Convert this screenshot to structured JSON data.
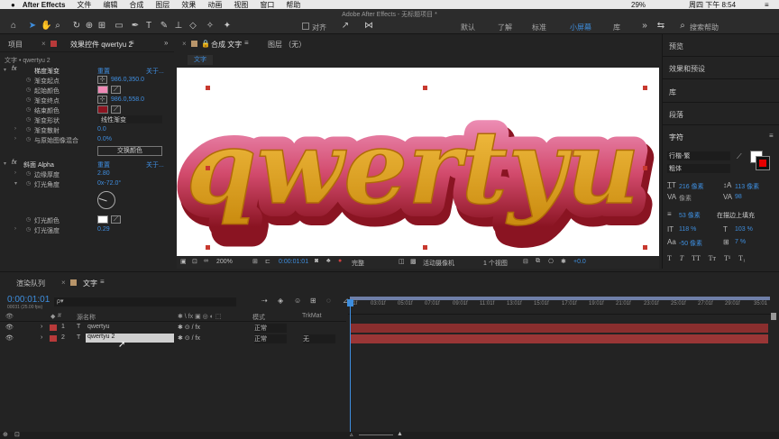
{
  "menubar": {
    "app": "After Effects",
    "items": [
      "文件",
      "编辑",
      "合成",
      "图层",
      "效果",
      "动画",
      "视图",
      "窗口",
      "帮助"
    ],
    "battery": "29%",
    "clock": "周四 下午 8:54"
  },
  "toolbar": {
    "title": "Adobe After Effects - 无标题项目 *",
    "align": "对齐",
    "workspaces": [
      "默认",
      "了解",
      "标准",
      "小屏幕",
      "库"
    ],
    "active_workspace": "小屏幕",
    "search_placeholder": "搜索帮助"
  },
  "left": {
    "tab_project": "项目",
    "tab_effects": "效果控件 qwertyu 2",
    "breadcrumb": "文字 • qwertyu 2",
    "gradient": {
      "name": "梯度渐变",
      "reset": "重置",
      "about": "关于...",
      "start_label": "渐变起点",
      "start_val": "986.0,350.0",
      "start_color_label": "起始颜色",
      "start_color": "#f08ab6",
      "end_label": "渐变终点",
      "end_val": "986.0,558.0",
      "end_color_label": "结束颜色",
      "end_color": "#8c1420",
      "shape_label": "渐变形状",
      "shape_val": "线性渐变",
      "scatter_label": "渐变散射",
      "scatter_val": "0.0",
      "blend_label": "与原始图像混合",
      "blend_val": "0.0%",
      "swap_btn": "交换颜色"
    },
    "bevel": {
      "name": "斜面 Alpha",
      "reset": "重置",
      "about": "关于...",
      "depth_label": "边缘厚度",
      "depth_val": "2.80",
      "angle_label": "灯光角度",
      "angle_val": "0x-72.0°",
      "light_color_label": "灯光颜色",
      "intensity_label": "灯光强度",
      "intensity_val": "0.29"
    }
  },
  "comp": {
    "tab": "合成 文字",
    "layer_tab": "图层 （无）",
    "subtab": "文字",
    "text": "qwertyu",
    "zoom": "200%",
    "time": "0:00:01:01",
    "quality": "完整",
    "camera": "活动摄像机",
    "views": "1 个视图",
    "exposure": "+0.0"
  },
  "right": {
    "items": [
      "预览",
      "效果和预设",
      "库",
      "段落"
    ],
    "char_title": "字符",
    "font": "行楷-繁",
    "style": "粗体",
    "size": "216 像素",
    "leading": "113 像素",
    "kern": "像素",
    "tracking": "98",
    "stroke_w": "53 像素",
    "stroke_mode": "在描边上填充",
    "vscale": "118 %",
    "hscale": "103 %",
    "baseline": "-50 像素",
    "tsume": "7 %",
    "fill_color": "#ffffff",
    "stroke_color": "#e60000"
  },
  "timeline": {
    "tab_render": "渲染队列",
    "tab_comp": "文字",
    "timecode": "0:00:01:01",
    "fps": "00031 (25.00 fps)",
    "search_placeholder": "ρ▾",
    "headers": {
      "name": "源名称",
      "mode": "模式",
      "trkmat": "TrkMat"
    },
    "layers": [
      {
        "num": "1",
        "name": "qwertyu",
        "mode": "正常",
        "trk": ""
      },
      {
        "num": "2",
        "name": "qwertyu 2",
        "mode": "正常",
        "trk": "无"
      }
    ],
    "ticks": [
      "01f",
      "03:01f",
      "05:01f",
      "07:01f",
      "09:01f",
      "11:01f",
      "13:01f",
      "15:01f",
      "17:01f",
      "19:01f",
      "21:01f",
      "23:01f",
      "25:01f",
      "27:01f",
      "29:01f",
      "35:01"
    ]
  }
}
